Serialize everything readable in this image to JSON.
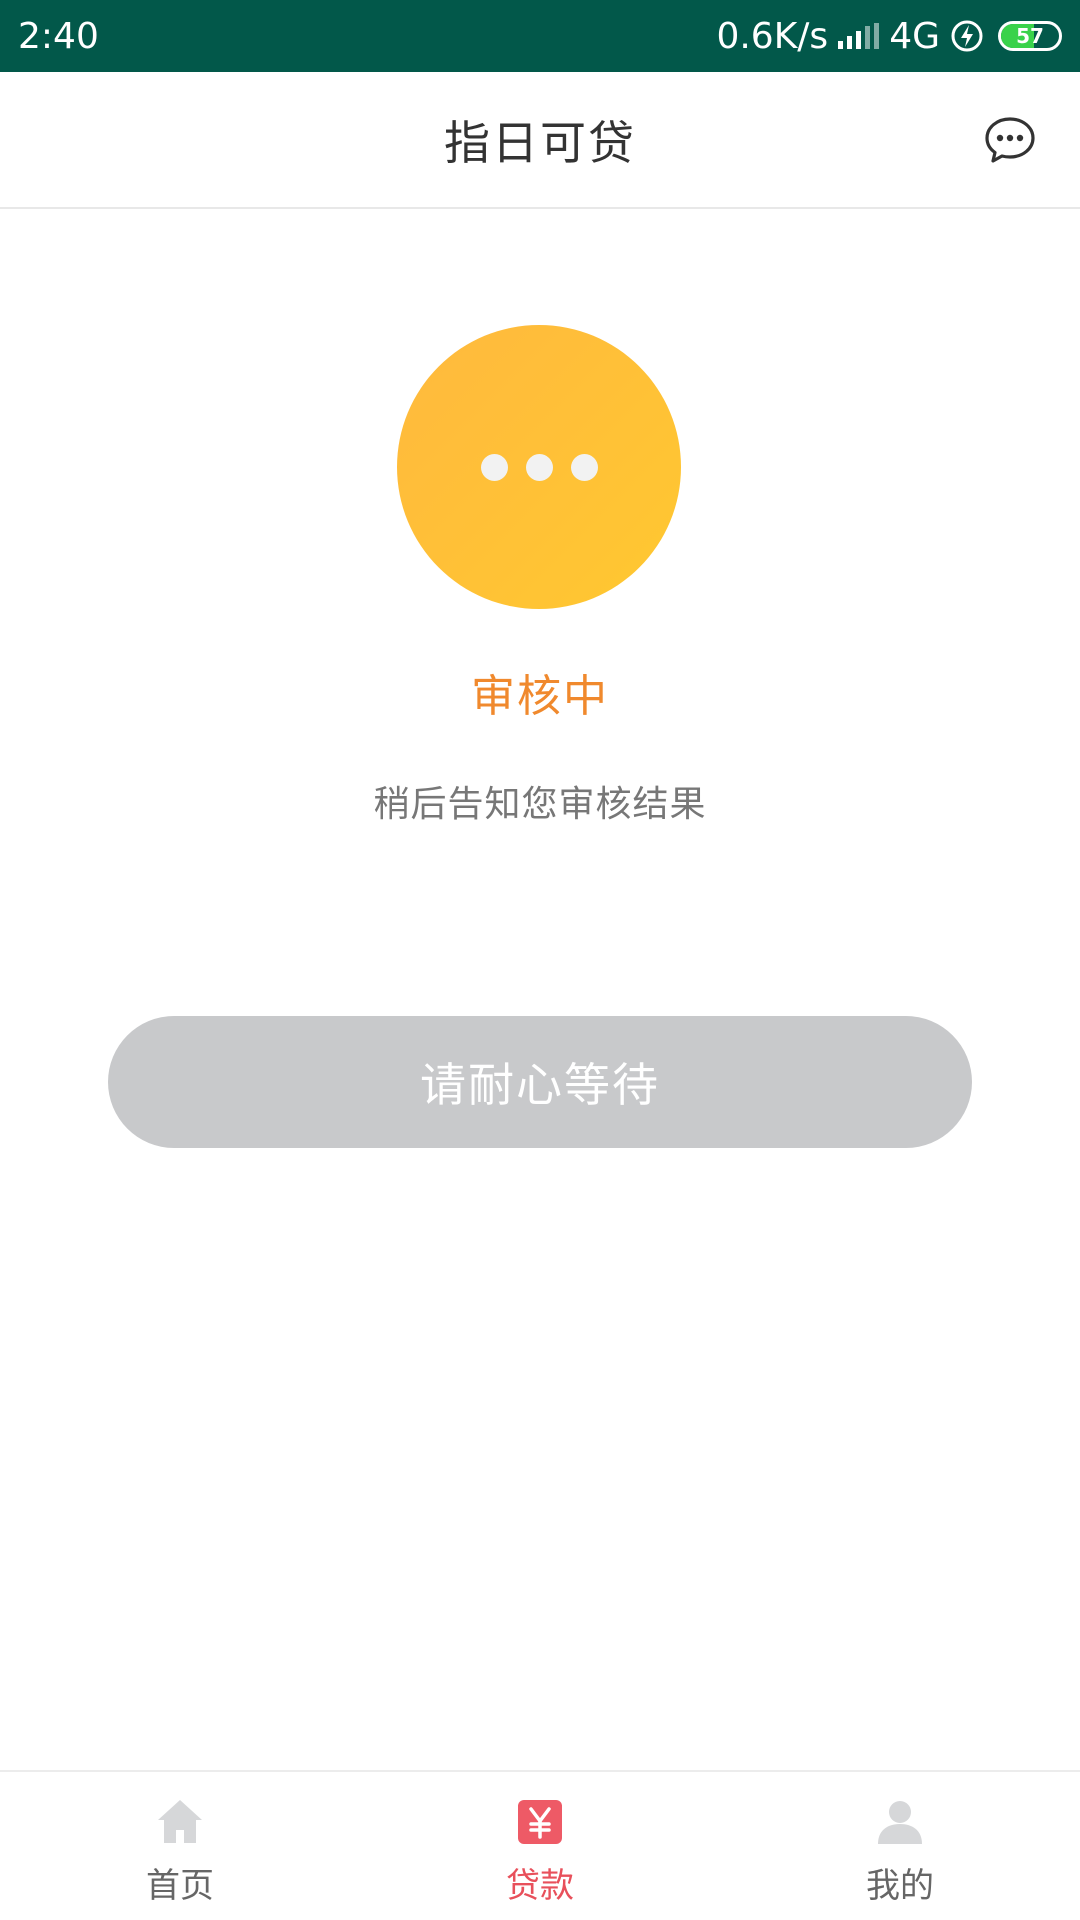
{
  "status_bar": {
    "time": "2:40",
    "net_speed": "0.6K/s",
    "network": "4G",
    "battery": "57",
    "battery_fraction": 0.57
  },
  "header": {
    "title": "指日可贷",
    "message_icon": "chat-bubble-icon"
  },
  "status": {
    "icon": "ellipsis-icon",
    "title": "审核中",
    "description": "稍后告知您审核结果",
    "circle_color": "#FFBF3A",
    "title_color": "#F0892D"
  },
  "action": {
    "label": "请耐心等待",
    "color": "#C8C9CB"
  },
  "tabbar": {
    "active_color": "#E8505B",
    "items": [
      {
        "label": "首页",
        "icon": "home-icon",
        "active": false
      },
      {
        "label": "贷款",
        "icon": "yen-loan-icon",
        "active": true
      },
      {
        "label": "我的",
        "icon": "user-icon",
        "active": false
      }
    ]
  }
}
